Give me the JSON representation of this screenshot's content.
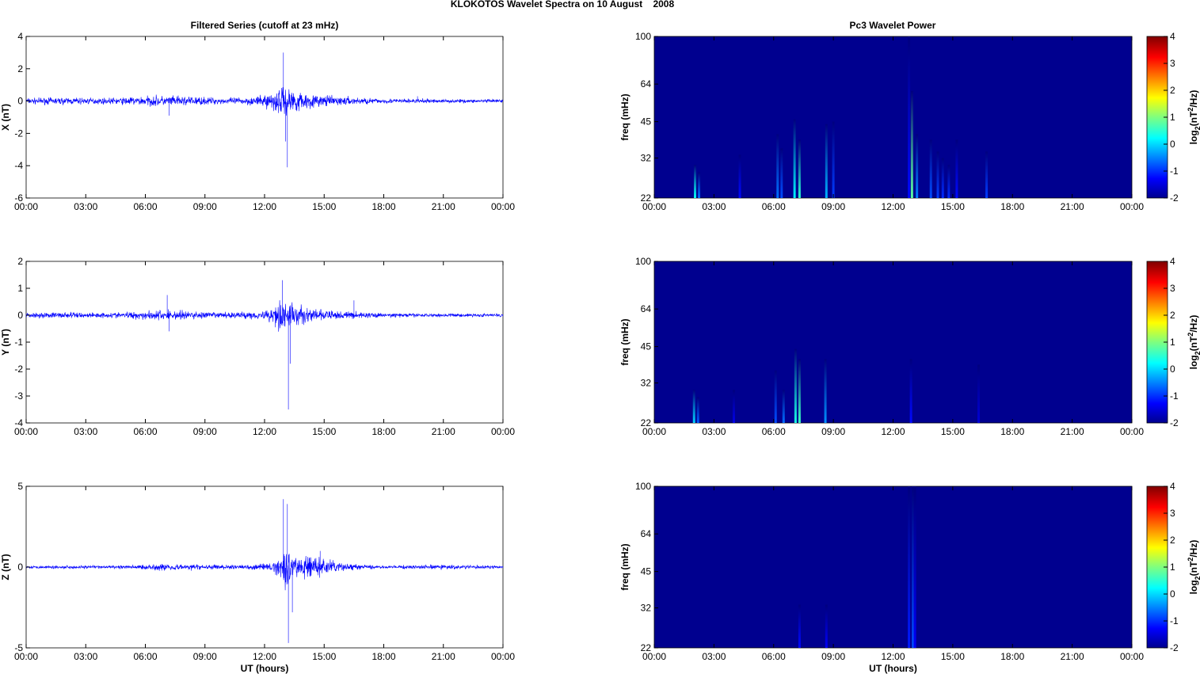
{
  "chart_data": {
    "title": "KLOKOTOS Wavelet Spectra on 10 August    2008",
    "type": "line",
    "left_title": "Filtered Series (cutoff at 23 mHz)",
    "right_title": "Pc3 Wavelet Power",
    "xlabel": "UT (hours)",
    "xticks": [
      "00:00",
      "03:00",
      "06:00",
      "09:00",
      "12:00",
      "15:00",
      "18:00",
      "21:00",
      "00:00"
    ],
    "xlim_hours": [
      0,
      24
    ],
    "series": [
      {
        "name": "X",
        "ylabel": "X (nT)",
        "ylim": [
          -6,
          4
        ],
        "yticks": [
          -6,
          -4,
          -2,
          0,
          2,
          4
        ],
        "envelope": [
          [
            0,
            0.12
          ],
          [
            2,
            0.15
          ],
          [
            4,
            0.12
          ],
          [
            6.5,
            0.22
          ],
          [
            8,
            0.2
          ],
          [
            10,
            0.12
          ],
          [
            11.8,
            0.2
          ],
          [
            12.8,
            0.6
          ],
          [
            13.5,
            0.5
          ],
          [
            14.5,
            0.25
          ],
          [
            16,
            0.18
          ],
          [
            18,
            0.1
          ],
          [
            21,
            0.08
          ],
          [
            24,
            0.07
          ]
        ],
        "spikes": [
          [
            12.95,
            3.0
          ],
          [
            13.15,
            -4.1
          ],
          [
            13.05,
            -2.5
          ],
          [
            7.2,
            -0.9
          ],
          [
            19.7,
            0.3
          ]
        ]
      },
      {
        "name": "Y",
        "ylabel": "Y (nT)",
        "ylim": [
          -4,
          2
        ],
        "yticks": [
          -4,
          -3,
          -2,
          -1,
          0,
          1,
          2
        ],
        "envelope": [
          [
            0,
            0.06
          ],
          [
            2,
            0.08
          ],
          [
            4,
            0.06
          ],
          [
            6.5,
            0.12
          ],
          [
            7.5,
            0.14
          ],
          [
            8.5,
            0.1
          ],
          [
            10,
            0.07
          ],
          [
            12,
            0.12
          ],
          [
            12.8,
            0.35
          ],
          [
            13.5,
            0.3
          ],
          [
            14.5,
            0.15
          ],
          [
            16,
            0.1
          ],
          [
            18,
            0.05
          ],
          [
            24,
            0.04
          ]
        ],
        "spikes": [
          [
            12.9,
            1.3
          ],
          [
            13.2,
            -3.5
          ],
          [
            7.1,
            0.75
          ],
          [
            7.2,
            -0.6
          ],
          [
            16.5,
            0.55
          ],
          [
            13.3,
            -1.8
          ]
        ]
      },
      {
        "name": "Z",
        "ylabel": "Z (nT)",
        "ylim": [
          -5,
          5
        ],
        "yticks": [
          -5,
          0,
          5
        ],
        "envelope": [
          [
            0,
            0.06
          ],
          [
            5,
            0.07
          ],
          [
            7,
            0.15
          ],
          [
            9,
            0.1
          ],
          [
            11,
            0.08
          ],
          [
            12.5,
            0.2
          ],
          [
            13,
            0.8
          ],
          [
            13.6,
            0.5
          ],
          [
            14.8,
            0.4
          ],
          [
            16,
            0.15
          ],
          [
            18,
            0.05
          ],
          [
            21,
            0.1
          ],
          [
            24,
            0.05
          ]
        ],
        "spikes": [
          [
            12.95,
            4.2
          ],
          [
            13.15,
            3.9
          ],
          [
            13.2,
            -4.7
          ],
          [
            13.4,
            -2.8
          ],
          [
            14.8,
            1.0
          ]
        ]
      }
    ],
    "wavelet": {
      "ylabel": "freq (mHz)",
      "yticks": [
        22,
        32,
        45,
        64,
        100
      ],
      "ylim_mHz": [
        22,
        100
      ],
      "colorbar_label": "log2(nT2/Hz)",
      "colorbar_ticks": [
        -2,
        -1,
        0,
        1,
        2,
        3,
        4
      ],
      "clim": [
        -2,
        4
      ],
      "events": [
        [
          [
            2.05,
            30,
            0.3
          ],
          [
            2.25,
            28,
            -0.6
          ],
          [
            4.3,
            33,
            -1.2
          ],
          [
            6.2,
            40,
            -0.6
          ],
          [
            6.4,
            35,
            -0.8
          ],
          [
            7.05,
            46,
            0.2
          ],
          [
            7.3,
            38,
            0.5
          ],
          [
            8.65,
            44,
            -0.2
          ],
          [
            9.0,
            45,
            -0.9
          ],
          [
            12.8,
            100,
            -1.2
          ],
          [
            12.95,
            60,
            0.8
          ],
          [
            13.2,
            40,
            -0.5
          ],
          [
            13.9,
            38,
            -0.8
          ],
          [
            14.25,
            34,
            -0.9
          ],
          [
            14.5,
            32,
            -1.0
          ],
          [
            14.8,
            30,
            -1.0
          ],
          [
            15.2,
            38,
            -1.2
          ],
          [
            16.7,
            34,
            -0.9
          ]
        ],
        [
          [
            2.0,
            30,
            0.0
          ],
          [
            2.2,
            28,
            -0.7
          ],
          [
            4.0,
            30,
            -1.4
          ],
          [
            6.1,
            36,
            -0.8
          ],
          [
            6.5,
            30,
            -0.6
          ],
          [
            7.1,
            44,
            0.4
          ],
          [
            7.3,
            40,
            0.6
          ],
          [
            8.6,
            40,
            -0.4
          ],
          [
            12.9,
            40,
            -1.2
          ],
          [
            16.3,
            38,
            -1.5
          ]
        ],
        [
          [
            7.3,
            33,
            -1.2
          ],
          [
            8.65,
            33,
            -1.3
          ],
          [
            12.8,
            100,
            -1.1
          ],
          [
            13.0,
            100,
            -0.8
          ],
          [
            13.1,
            100,
            -1.3
          ]
        ]
      ]
    }
  }
}
